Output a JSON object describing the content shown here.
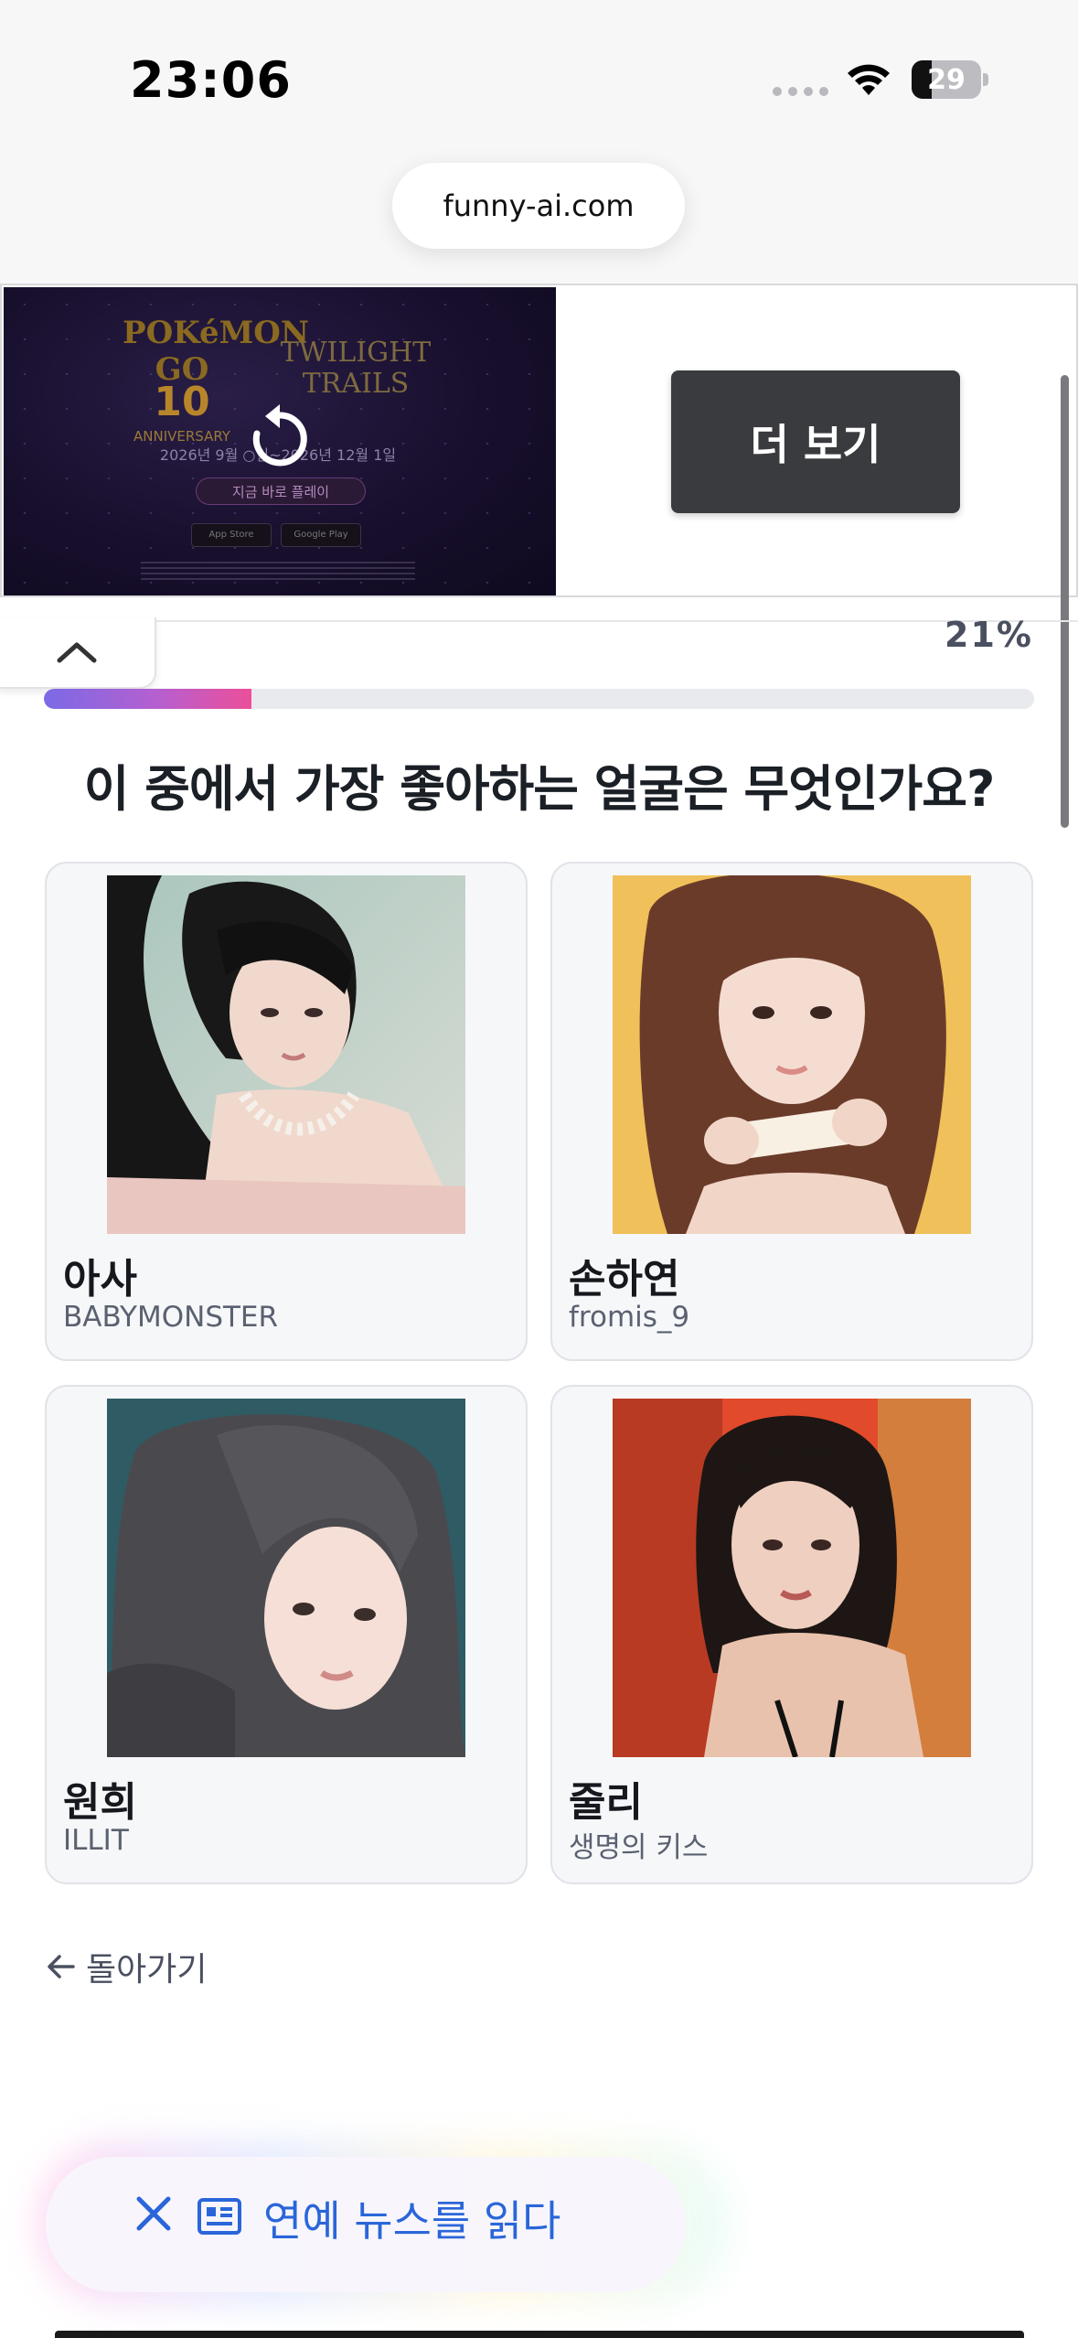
{
  "status_bar": {
    "time": "23:06",
    "battery": "29"
  },
  "browser": {
    "url": "funny-ai.com"
  },
  "ad": {
    "logo_left_title": "POKéMON GO",
    "logo_left_badge": "10",
    "logo_left_sub": "ANNIVERSARY",
    "logo_right": "TWILIGHT TRAILS",
    "date_text": "2026년 9월 ○일~2026년 12월 1일",
    "cta_text": "지금 바로 플레이",
    "store_badges": [
      "App Store",
      "Google Play"
    ],
    "more_button": "더 보기"
  },
  "quiz": {
    "progress_text": "21%",
    "progress_value": 0.21,
    "question": "이 중에서 가장 좋아하는 얼굴은 무엇인가요?",
    "options": [
      {
        "name": "아사",
        "group": "BABYMONSTER"
      },
      {
        "name": "손하연",
        "group": "fromis_9"
      },
      {
        "name": "원희",
        "group": "ILLIT"
      },
      {
        "name": "줄리",
        "group": "생명의 키스"
      }
    ],
    "back_label": "돌아가기"
  },
  "bottom_bar": {
    "news_label": "연예 뉴스를 읽다"
  },
  "colors": {
    "accent_blue": "#2a66d9",
    "button_dark": "#3a3b3e",
    "progress_start": "#7b6ae6",
    "progress_end": "#ec4f9a"
  }
}
